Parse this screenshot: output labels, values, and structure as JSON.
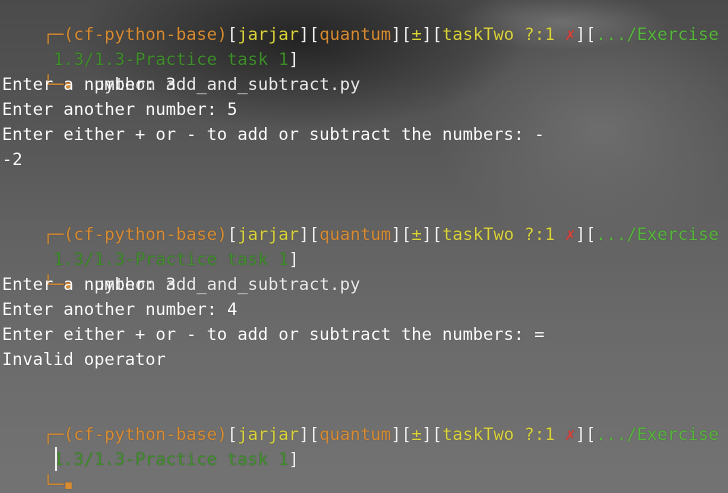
{
  "prompt": {
    "corner_top": "┌─",
    "env": "(cf-python-base)",
    "user": "jarjar",
    "host": "quantum",
    "git_symbol": "±",
    "branch": "taskTwo ?:1",
    "status_mark": "✗",
    "path_part1": ".../Exercise",
    "corner_bottom": "└─▪",
    "b_open": "[",
    "b_close": "]"
  },
  "blocks": [
    {
      "path_part2": " 1.3/1.3-Practice task 1",
      "command": "python add_and_subtract.py",
      "outputs": [
        "Enter a number: 3",
        "Enter another number: 5",
        "Enter either + or - to add or subtract the numbers: -",
        "-2"
      ]
    },
    {
      "path_part2": " 1.3/1.3-Practice task 1",
      "command": "python add_and_subtract.py",
      "outputs": [
        "Enter a number: 3",
        "Enter another number: 4",
        "Enter either + or - to add or subtract the numbers: =",
        "Invalid operator"
      ]
    },
    {
      "path_part2": " 1.3/1.3-Practice task 1",
      "command": "",
      "outputs": []
    }
  ],
  "colors": {
    "prompt_corner": "#d98c32",
    "env": "#d98c32",
    "user": "#dcd43a",
    "host": "#d98c32",
    "branch": "#dcd43a",
    "status_mark": "#e0413a",
    "path": "#56b83a"
  }
}
